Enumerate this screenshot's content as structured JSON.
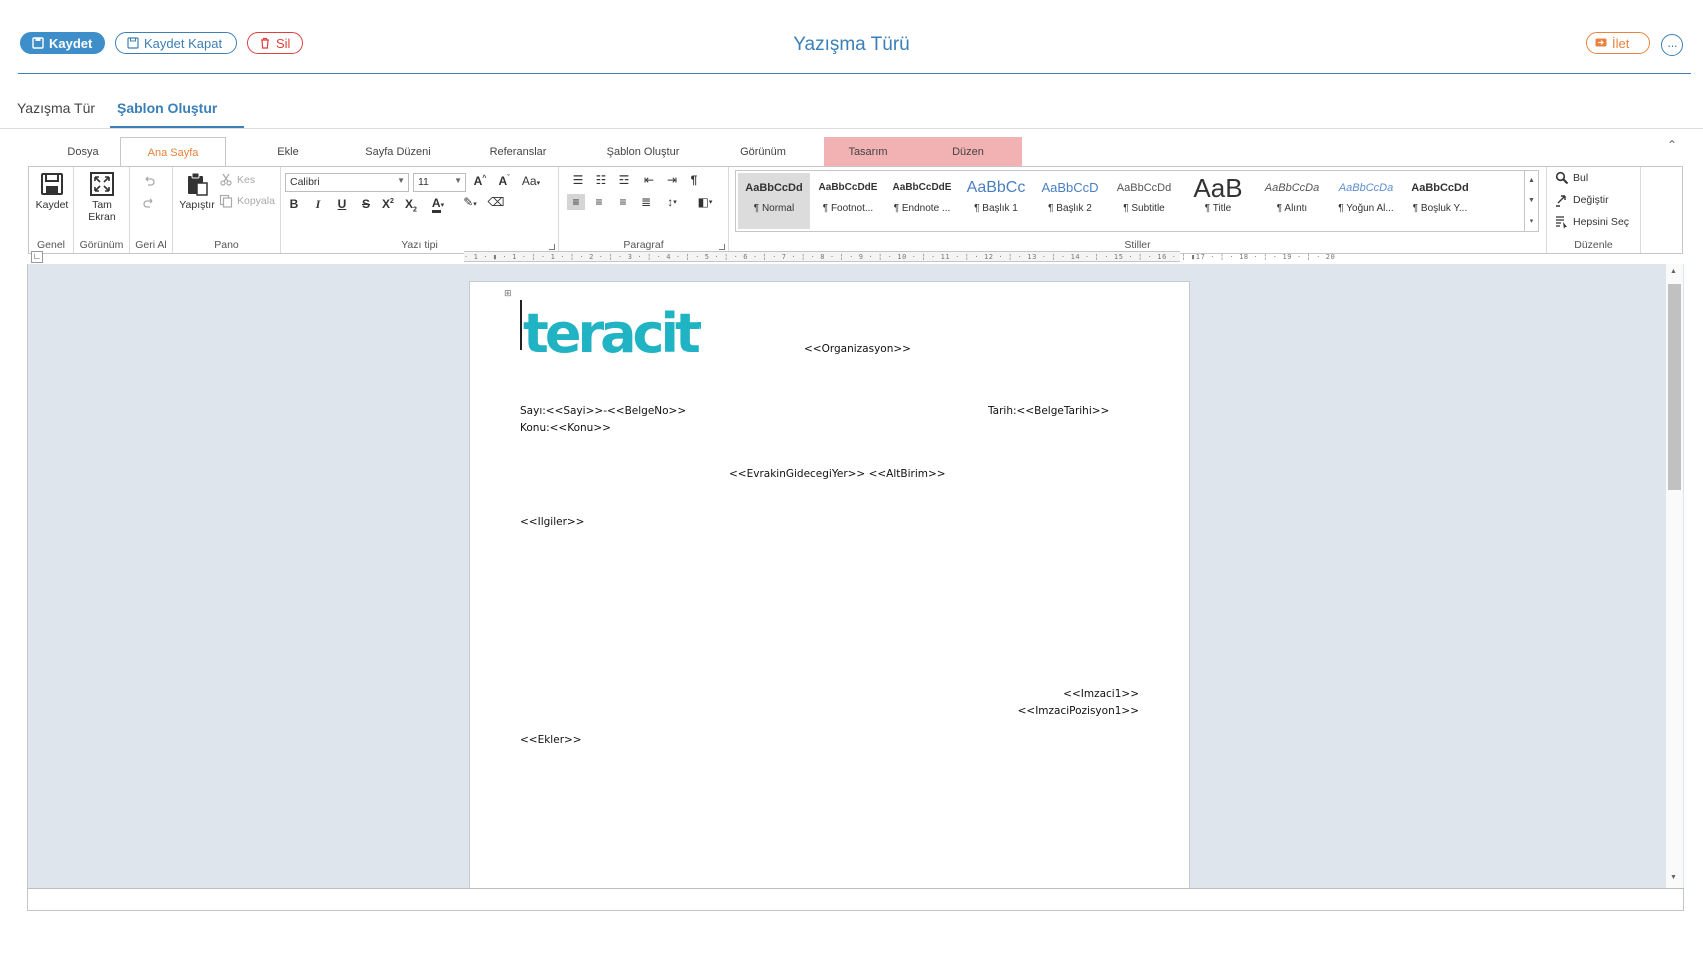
{
  "toolbar": {
    "save_label": "Kaydet",
    "save_close_label": "Kaydet Kapat",
    "delete_label": "Sil",
    "forward_label": "İlet",
    "more_label": "···"
  },
  "page_title": "Yazışma Türü",
  "page_tabs": [
    {
      "label": "Yazışma Tür",
      "active": false
    },
    {
      "label": "Şablon Oluştur",
      "active": true
    }
  ],
  "ribbon_tabs": [
    "Dosya",
    "Ana Sayfa",
    "Ekle",
    "Sayfa Düzeni",
    "Referanslar",
    "Şablon Oluştur",
    "Görünüm",
    "Tasarım",
    "Düzen"
  ],
  "ribbon_active_tab": "Ana Sayfa",
  "ribbon": {
    "genel": {
      "label": "Genel",
      "save": "Kaydet"
    },
    "gorunum": {
      "label": "Görünüm",
      "fullscreen_line1": "Tam",
      "fullscreen_line2": "Ekran"
    },
    "geri_al": {
      "label": "Geri Al"
    },
    "pano": {
      "label": "Pano",
      "paste": "Yapıştır",
      "cut": "Kes",
      "copy": "Kopyala"
    },
    "yazi_tipi": {
      "label": "Yazı tipi",
      "font": "Calibri",
      "size": "11"
    },
    "paragraf": {
      "label": "Paragraf"
    },
    "stiller": {
      "label": "Stiller",
      "items": [
        {
          "sample": "AaBbCcDd",
          "name": "¶ Normal"
        },
        {
          "sample": "AaBbCcDdE",
          "name": "¶ Footnot..."
        },
        {
          "sample": "AaBbCcDdE",
          "name": "¶ Endnote ..."
        },
        {
          "sample": "AaBbCc",
          "name": "¶ Başlık 1"
        },
        {
          "sample": "AaBbCcD",
          "name": "¶ Başlık 2"
        },
        {
          "sample": "AaBbCcDd",
          "name": "¶ Subtitle"
        },
        {
          "sample": "AaB",
          "name": "¶ Title"
        },
        {
          "sample": "AaBbCcDa",
          "name": "¶ Alıntı"
        },
        {
          "sample": "AaBbCcDa",
          "name": "¶ Yoğun Al..."
        },
        {
          "sample": "AaBbCcDd",
          "name": "¶ Boşluk Y..."
        }
      ]
    },
    "duzenle": {
      "label": "Düzenle",
      "find": "Bul",
      "replace": "Değiştir",
      "select_all": "Hepsini Seç"
    }
  },
  "ruler_text": "· 1 · ▮ · 1 · ¦ · 1 · ¦ · 2 · ¦ · 3 · ¦ · 4 · ¦ · 5 · ¦ · 6 · ¦ · 7 · ¦ · 8 · ¦ · 9 · ¦ · 10 · ¦ · 11 · ¦ · 12 · ¦ · 13 · ¦ · 14 · ¦ · 15 · ¦ · 16 · ¦ ▮17 · ¦ · 18 · ¦ · 19 · ¦ · 20",
  "document": {
    "logo_text": "teracity",
    "organization": "<<Organizasyon>>",
    "sayi": "Sayı:<<Sayi>>-<<BelgeNo>>",
    "tarih": "Tarih:<<BelgeTarihi>>",
    "konu": "Konu:<<Konu>>",
    "recipient": "<<EvrakinGidecegiYer>>  <<AltBirim>>",
    "ilgiler": "<<Ilgiler>>",
    "imzaci": "<<Imzaci1>>",
    "imzaci_pozisyon": "<<ImzaciPozisyon1>>",
    "ekler": "<<Ekler>>"
  },
  "colors": {
    "accent": "#3d7fb5",
    "danger": "#e0413d",
    "warning": "#e8823e",
    "context_tab": "#f2b1b2",
    "logo": "#1fb3c3",
    "editor_bg": "#dfe5ed"
  }
}
